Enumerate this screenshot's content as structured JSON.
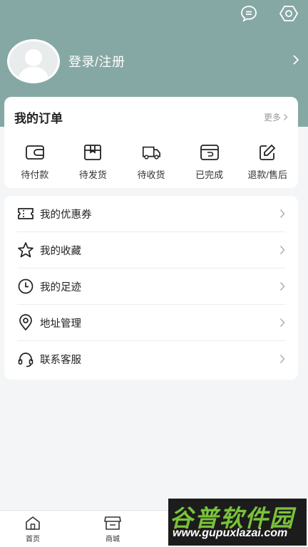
{
  "header": {
    "login_label": "登录/注册",
    "icons": [
      "chat-icon",
      "settings-icon"
    ],
    "bg_color": "#86a8a4"
  },
  "orders": {
    "title": "我的订单",
    "more_label": "更多",
    "items": [
      {
        "label": "待付款",
        "icon": "wallet-icon"
      },
      {
        "label": "待发货",
        "icon": "package-icon"
      },
      {
        "label": "待收货",
        "icon": "truck-icon"
      },
      {
        "label": "已完成",
        "icon": "completed-box-icon"
      },
      {
        "label": "退款/售后",
        "icon": "edit-icon"
      }
    ]
  },
  "menu": {
    "items": [
      {
        "label": "我的优惠券",
        "icon": "coupon-icon"
      },
      {
        "label": "我的收藏",
        "icon": "star-icon"
      },
      {
        "label": "我的足迹",
        "icon": "clock-icon"
      },
      {
        "label": "地址管理",
        "icon": "location-icon"
      },
      {
        "label": "联系客服",
        "icon": "headset-icon"
      }
    ]
  },
  "tabbar": {
    "items": [
      {
        "label": "首页",
        "icon": "home-icon"
      },
      {
        "label": "商城",
        "icon": "shop-icon"
      }
    ]
  },
  "watermark": {
    "title": "谷普软件园",
    "url": "www.gupuxlazai.com"
  }
}
